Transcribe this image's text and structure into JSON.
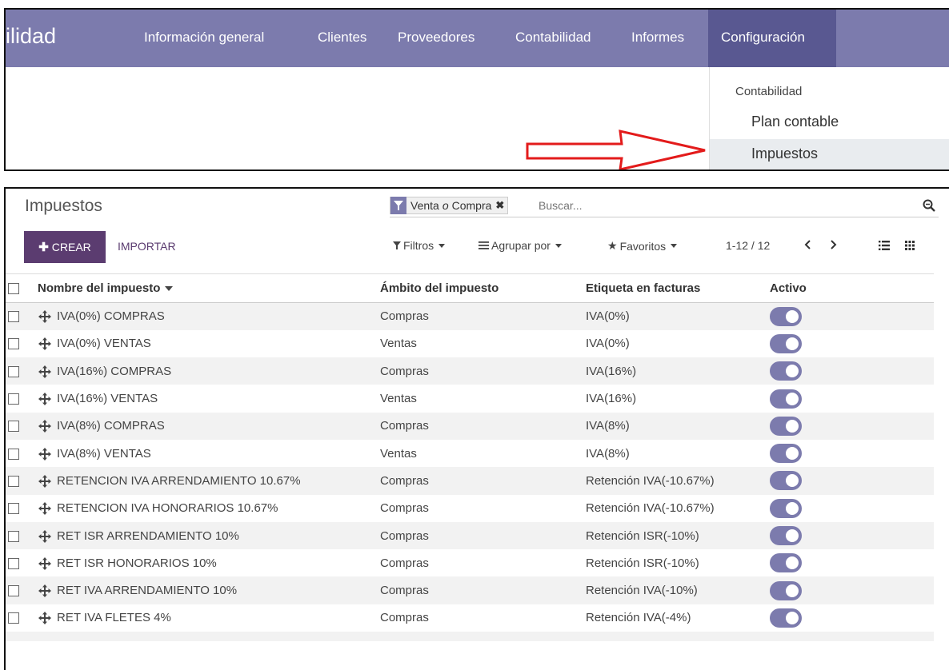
{
  "navbar": {
    "app_title": "ilidad",
    "items": [
      "Información general",
      "Clientes",
      "Proveedores",
      "Contabilidad",
      "Informes"
    ],
    "active_item": "Configuración"
  },
  "dropdown": {
    "section_header": "Contabilidad",
    "items": [
      "Plan contable",
      "Impuestos"
    ],
    "highlighted": "Impuestos"
  },
  "colors": {
    "navbar": "#7c7bad",
    "navbar_active": "#595891",
    "primary_button": "#5b3c70",
    "arrow": "#e31b1b",
    "toggle_on": "#7c7bad"
  },
  "list_view": {
    "title": "Impuestos",
    "search": {
      "facet_left": "Venta",
      "facet_or": "o",
      "facet_right": "Compra",
      "placeholder": "Buscar..."
    },
    "buttons": {
      "create": "CREAR",
      "import": "IMPORTAR"
    },
    "filters": {
      "filters": "Filtros",
      "group_by": "Agrupar por",
      "favorites": "Favoritos"
    },
    "pager": "1-12 / 12",
    "columns": [
      "Nombre del impuesto",
      "Ámbito del impuesto",
      "Etiqueta en facturas",
      "Activo"
    ],
    "rows": [
      {
        "name": "IVA(0%) COMPRAS",
        "scope": "Compras",
        "label": "IVA(0%)",
        "active": true
      },
      {
        "name": "IVA(0%) VENTAS",
        "scope": "Ventas",
        "label": "IVA(0%)",
        "active": true
      },
      {
        "name": "IVA(16%) COMPRAS",
        "scope": "Compras",
        "label": "IVA(16%)",
        "active": true
      },
      {
        "name": "IVA(16%) VENTAS",
        "scope": "Ventas",
        "label": "IVA(16%)",
        "active": true
      },
      {
        "name": "IVA(8%) COMPRAS",
        "scope": "Compras",
        "label": "IVA(8%)",
        "active": true
      },
      {
        "name": "IVA(8%) VENTAS",
        "scope": "Ventas",
        "label": "IVA(8%)",
        "active": true
      },
      {
        "name": "RETENCION IVA ARRENDAMIENTO 10.67%",
        "scope": "Compras",
        "label": "Retención IVA(-10.67%)",
        "active": true
      },
      {
        "name": "RETENCION IVA HONORARIOS 10.67%",
        "scope": "Compras",
        "label": "Retención IVA(-10.67%)",
        "active": true
      },
      {
        "name": "RET ISR ARRENDAMIENTO 10%",
        "scope": "Compras",
        "label": "Retención ISR(-10%)",
        "active": true
      },
      {
        "name": "RET ISR HONORARIOS 10%",
        "scope": "Compras",
        "label": "Retención ISR(-10%)",
        "active": true
      },
      {
        "name": "RET IVA ARRENDAMIENTO 10%",
        "scope": "Compras",
        "label": "Retención IVA(-10%)",
        "active": true
      },
      {
        "name": "RET IVA FLETES 4%",
        "scope": "Compras",
        "label": "Retención IVA(-4%)",
        "active": true
      }
    ]
  }
}
